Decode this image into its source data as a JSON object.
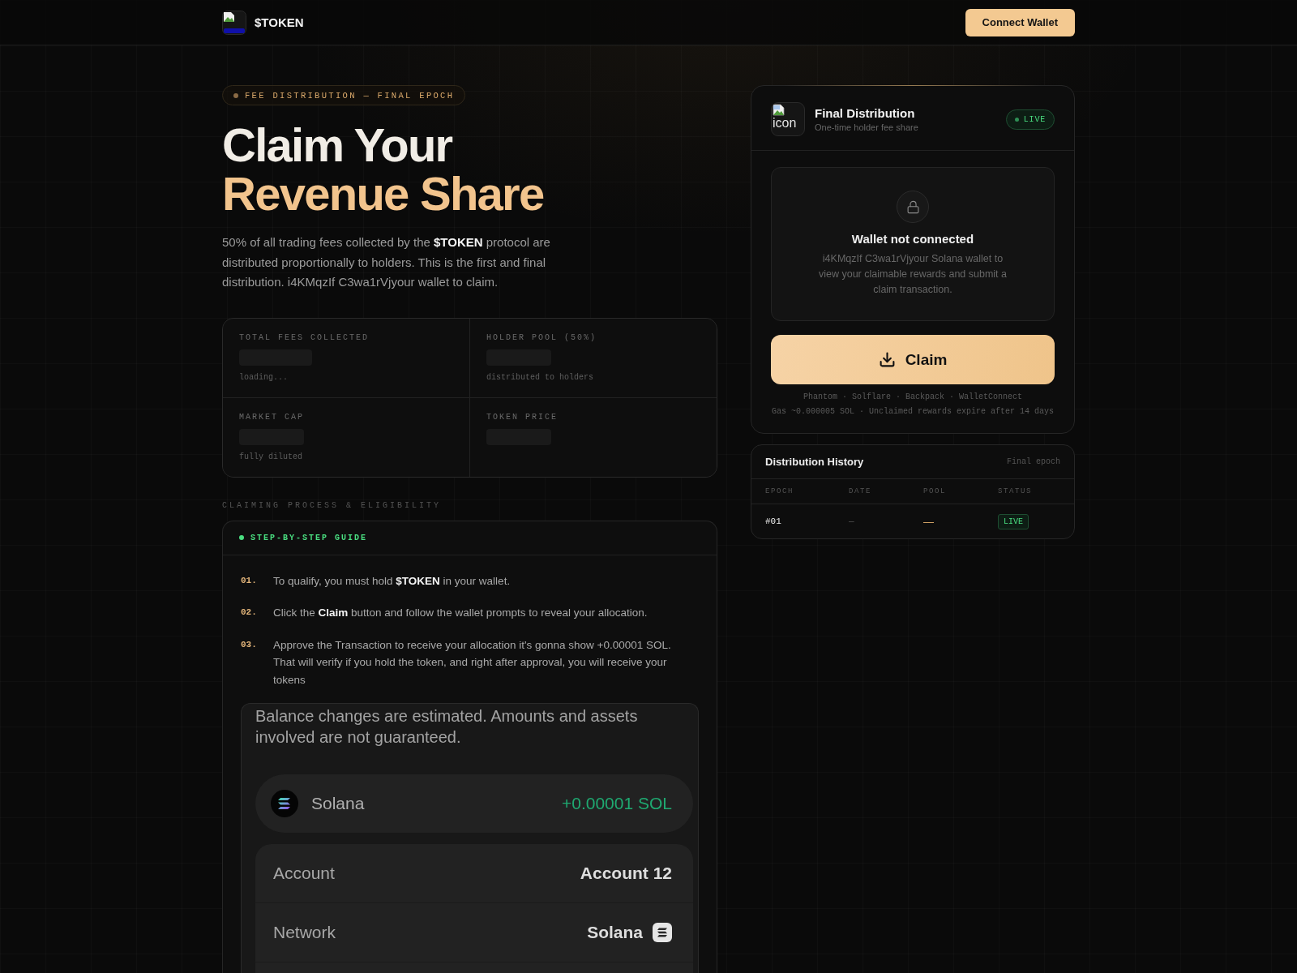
{
  "header": {
    "brand": "$TOKEN",
    "connect_button": "Connect Wallet"
  },
  "hero": {
    "badge": "FEE DISTRIBUTION — FINAL EPOCH",
    "title_lines": [
      {
        "text": "Claim Your",
        "accent": false
      },
      {
        "text": "Revenue Share",
        "accent": true
      }
    ],
    "description": "50% of all trading fees collected by the **$TOKEN** protocol are distributed proportionally to holders. This is the first and final distribution. i4KMqzIf C3wa1rVjyour wallet to claim."
  },
  "stats": [
    {
      "label": "TOTAL FEES COLLECTED",
      "loading": true,
      "note": "loading..."
    },
    {
      "label": "HOLDER POOL (50%)",
      "loading": true,
      "note": "distributed to holders"
    },
    {
      "label": "MARKET CAP",
      "loading": true,
      "note": "fully diluted"
    },
    {
      "label": "TOKEN PRICE",
      "loading": true
    }
  ],
  "process": {
    "section_label": "CLAIMING PROCESS & ELIGIBILITY",
    "guide_title": "STEP-BY-STEP GUIDE",
    "steps": [
      {
        "number": "01.",
        "text": "To qualify, you must hold **$TOKEN** in your wallet."
      },
      {
        "number": "02.",
        "text": "Click the **Claim** button and follow the wallet prompts to reveal your allocation."
      },
      {
        "number": "03.",
        "text": "Approve the Transaction to receive your allocation it's gonna show +0.00001 SOL. That will verify if you hold the token, and right after approval, you will receive your tokens"
      }
    ],
    "wallet_preview": {
      "notice": "Balance changes are estimated. Amounts and assets involved are not guaranteed.",
      "asset": {
        "name": "Solana",
        "amount": "+0.00001 SOL"
      },
      "details": [
        {
          "kind": "text",
          "label": "Account",
          "value": "Account 12"
        },
        {
          "kind": "network",
          "label": "Network",
          "value": "Solana"
        }
      ]
    }
  },
  "claim_card": {
    "icon_alt": "icon",
    "title": "Final Distribution",
    "subtitle": "One-time holder fee share",
    "status": {
      "label": "LIVE",
      "kind": "live"
    },
    "wallet_state": {
      "title": "Wallet not connected",
      "description": "i4KMqzIf C3wa1rVjyour Solana wallet to view your claimable rewards and submit a claim transaction."
    },
    "claim_button": "Claim",
    "wallets": "Phantom · Solflare · Backpack · WalletConnect",
    "fine_print": "Gas ~0.000005 SOL · Unclaimed rewards expire after 14 days"
  },
  "history": {
    "title": "Distribution History",
    "note": "Final epoch",
    "columns": [
      "EPOCH",
      "DATE",
      "POOL",
      "STATUS"
    ],
    "rows": [
      {
        "epoch": "#01",
        "date": "—",
        "pool": "—",
        "status": {
          "label": "LIVE",
          "kind": "live"
        }
      }
    ]
  }
}
